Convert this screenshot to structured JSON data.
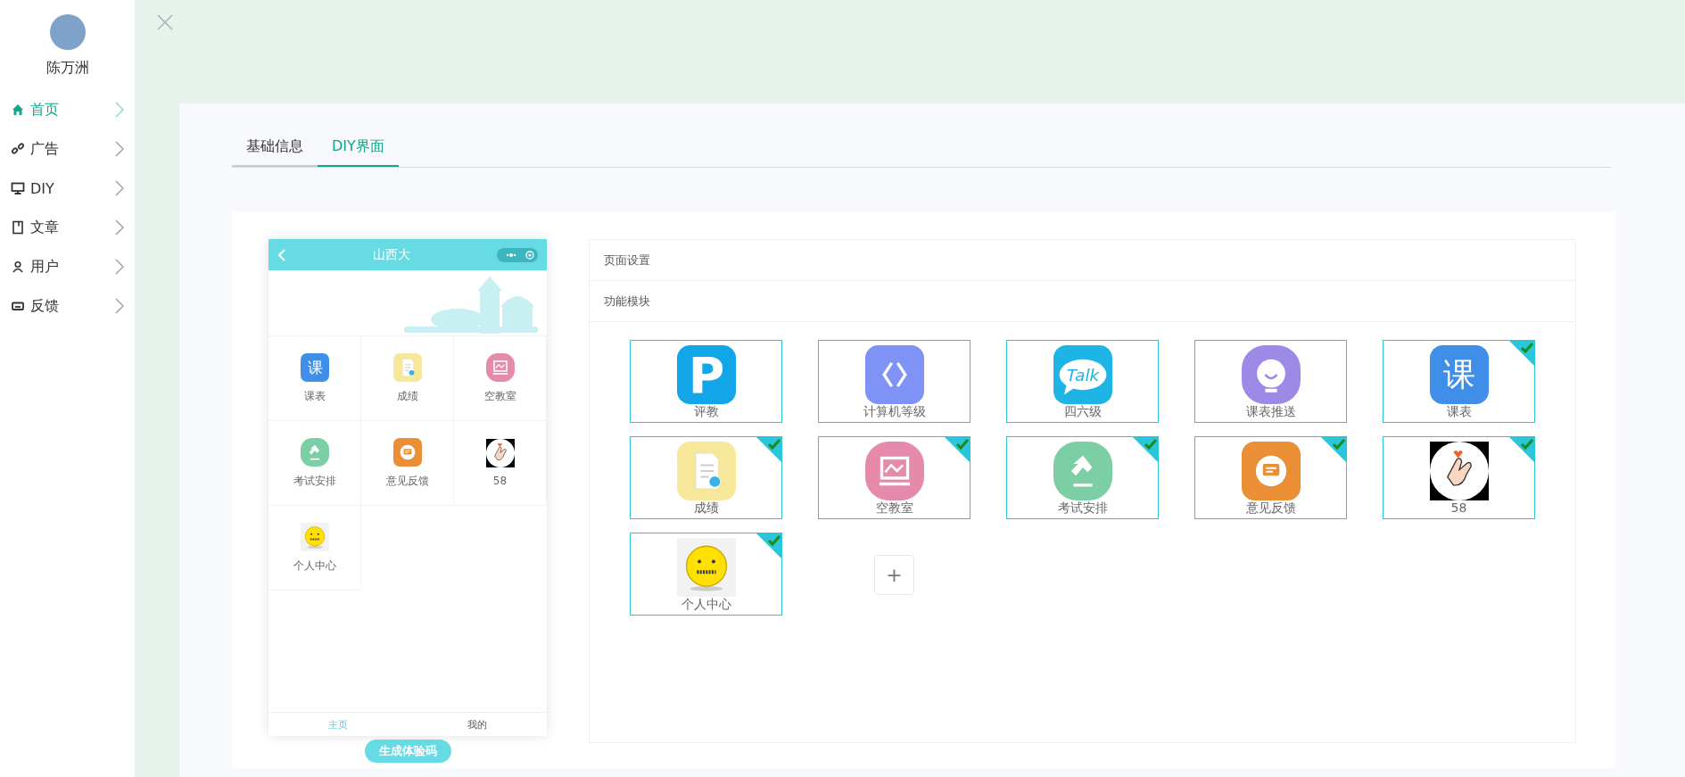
{
  "sidebar": {
    "user_name": "陈万洲",
    "items": [
      {
        "label": "首页",
        "kind": "home",
        "selected": true
      },
      {
        "label": "广告",
        "kind": "link",
        "selected": false
      },
      {
        "label": "DIY",
        "kind": "monitor",
        "selected": false
      },
      {
        "label": "文章",
        "kind": "book",
        "selected": false
      },
      {
        "label": "用户",
        "kind": "user",
        "selected": false
      },
      {
        "label": "反馈",
        "kind": "card",
        "selected": false
      }
    ]
  },
  "tabs": [
    {
      "label": "基础信息",
      "selected": false
    },
    {
      "label": "DIY界面",
      "selected": true
    }
  ],
  "phone": {
    "title": "山西大",
    "grid": [
      {
        "label": "课表",
        "kind": "course",
        "glyph": "课"
      },
      {
        "label": "成绩",
        "kind": "grade"
      },
      {
        "label": "空教室",
        "kind": "room"
      },
      {
        "label": "考试安排",
        "kind": "exam"
      },
      {
        "label": "意见反馈",
        "kind": "feedback"
      },
      {
        "label": "58",
        "kind": "hand"
      },
      {
        "label": "个人中心",
        "kind": "emoji"
      }
    ],
    "bottom_tabs": [
      {
        "label": "主页",
        "selected": true
      },
      {
        "label": "我的",
        "selected": false
      }
    ],
    "generate_button": "生成体验码"
  },
  "settings": {
    "sections": [
      "页面设置",
      "功能模块"
    ],
    "modules": [
      {
        "label": "评教",
        "kind": "p",
        "glyph": "P",
        "selected": false
      },
      {
        "label": "计算机等级",
        "kind": "code",
        "selected": false
      },
      {
        "label": "四六级",
        "kind": "talk",
        "glyph": "Talk",
        "selected": false
      },
      {
        "label": "课表推送",
        "kind": "bot",
        "selected": false
      },
      {
        "label": "课表",
        "kind": "course",
        "glyph": "课",
        "selected": true
      },
      {
        "label": "成绩",
        "kind": "grade",
        "selected": true
      },
      {
        "label": "空教室",
        "kind": "room",
        "selected": true
      },
      {
        "label": "考试安排",
        "kind": "exam",
        "selected": true
      },
      {
        "label": "意见反馈",
        "kind": "feedback",
        "selected": true
      },
      {
        "label": "58",
        "kind": "hand",
        "selected": true
      },
      {
        "label": "个人中心",
        "kind": "emoji",
        "selected": true
      }
    ],
    "add_button": "+"
  }
}
